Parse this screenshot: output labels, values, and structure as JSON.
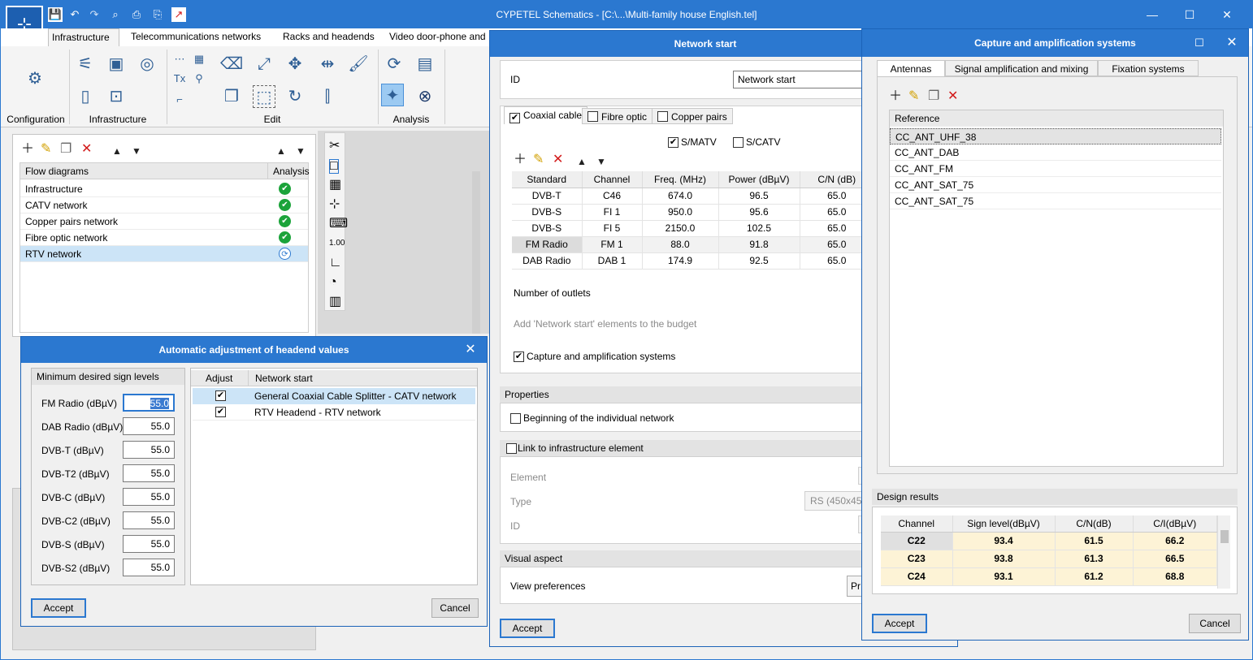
{
  "window": {
    "title": "CYPETEL Schematics - [C:\\...\\Multi-family house English.tel]",
    "controls": {
      "minimize": "—",
      "maximize": "☐",
      "close": "✕"
    }
  },
  "ribbon": {
    "tabs": [
      "Infrastructure",
      "Telecommunications networks",
      "Racks and headends",
      "Video door-phone and"
    ],
    "active_tab": "Infrastructure",
    "groups": [
      "Configuration",
      "Infrastructure",
      "Edit",
      "Analysis"
    ]
  },
  "flow_panel": {
    "columns": [
      "Flow diagrams",
      "Analysis"
    ],
    "rows": [
      {
        "name": "Infrastructure",
        "status": "ok"
      },
      {
        "name": "CATV network",
        "status": "ok"
      },
      {
        "name": "Copper pairs network",
        "status": "ok"
      },
      {
        "name": "Fibre optic network",
        "status": "ok"
      },
      {
        "name": "RTV network",
        "status": "pending"
      }
    ]
  },
  "auto_adjust": {
    "title": "Automatic adjustment of headend values",
    "levels_header": "Minimum desired sign levels",
    "levels": [
      {
        "label": "FM Radio (dBµV)",
        "value": "55.0"
      },
      {
        "label": "DAB Radio (dBµV)",
        "value": "55.0"
      },
      {
        "label": "DVB-T (dBµV)",
        "value": "55.0"
      },
      {
        "label": "DVB-T2 (dBµV)",
        "value": "55.0"
      },
      {
        "label": "DVB-C (dBµV)",
        "value": "55.0"
      },
      {
        "label": "DVB-C2 (dBµV)",
        "value": "55.0"
      },
      {
        "label": "DVB-S (dBµV)",
        "value": "55.0"
      },
      {
        "label": "DVB-S2 (dBµV)",
        "value": "55.0"
      }
    ],
    "table_columns": [
      "Adjust",
      "Network start"
    ],
    "table_rows": [
      {
        "adjust": "✔",
        "name": "General Coaxial Cable Splitter - CATV network"
      },
      {
        "adjust": "✔",
        "name": "RTV Headend - RTV network"
      }
    ],
    "accept": "Accept",
    "cancel": "Cancel"
  },
  "network_start": {
    "title": "Network start",
    "id_label": "ID",
    "id_value": "Network start",
    "media_tabs": [
      "Coaxial cable",
      "Fibre optic",
      "Copper pairs"
    ],
    "smatv": "S/MATV",
    "scatv": "S/CATV",
    "columns": [
      "Standard",
      "Channel",
      "Freq. (MHz)",
      "Power (dBµV)",
      "C/N (dB)"
    ],
    "rows": [
      [
        "DVB-T",
        "C46",
        "674.0",
        "96.5",
        "65.0"
      ],
      [
        "DVB-S",
        "FI 1",
        "950.0",
        "95.6",
        "65.0"
      ],
      [
        "DVB-S",
        "FI 5",
        "2150.0",
        "102.5",
        "65.0"
      ],
      [
        "FM Radio",
        "FM 1",
        "88.0",
        "91.8",
        "65.0"
      ],
      [
        "DAB Radio",
        "DAB 1",
        "174.9",
        "92.5",
        "65.0"
      ]
    ],
    "outlets_label": "Number of outlets",
    "budget_label": "Add 'Network start' elements to the budget",
    "capture_label": "Capture and amplification systems",
    "properties_header": "Properties",
    "beginning_label": "Beginning of the individual network",
    "link_label": "Link to infrastructure element",
    "element_label": "Element",
    "type_label": "Type",
    "type_value": "RS (450x450x",
    "id2_label": "ID",
    "visual_header": "Visual aspect",
    "view_pref_label": "View preferences",
    "view_pref_value": "Pr",
    "accept": "Accept"
  },
  "capture": {
    "title": "Capture and amplification systems",
    "tabs": [
      "Antennas",
      "Signal amplification and mixing",
      "Fixation systems"
    ],
    "ref_header": "Reference",
    "references": [
      "CC_ANT_UHF_38",
      "CC_ANT_DAB",
      "CC_ANT_FM",
      "CC_ANT_SAT_75",
      "CC_ANT_SAT_75"
    ],
    "design_header": "Design results",
    "design_columns": [
      "Channel",
      "Sign level(dBµV)",
      "C/N(dB)",
      "C/I(dBµV)"
    ],
    "design_rows": [
      [
        "C22",
        "93.4",
        "61.5",
        "66.2"
      ],
      [
        "C23",
        "93.8",
        "61.3",
        "66.5"
      ],
      [
        "C24",
        "93.1",
        "61.2",
        "68.8"
      ]
    ],
    "accept": "Accept",
    "cancel": "Cancel"
  },
  "colors": {
    "accent": "#2b78d0",
    "selection": "#cce4f7",
    "ok": "#1ba33a",
    "results_bg": "#fdf3d6"
  }
}
